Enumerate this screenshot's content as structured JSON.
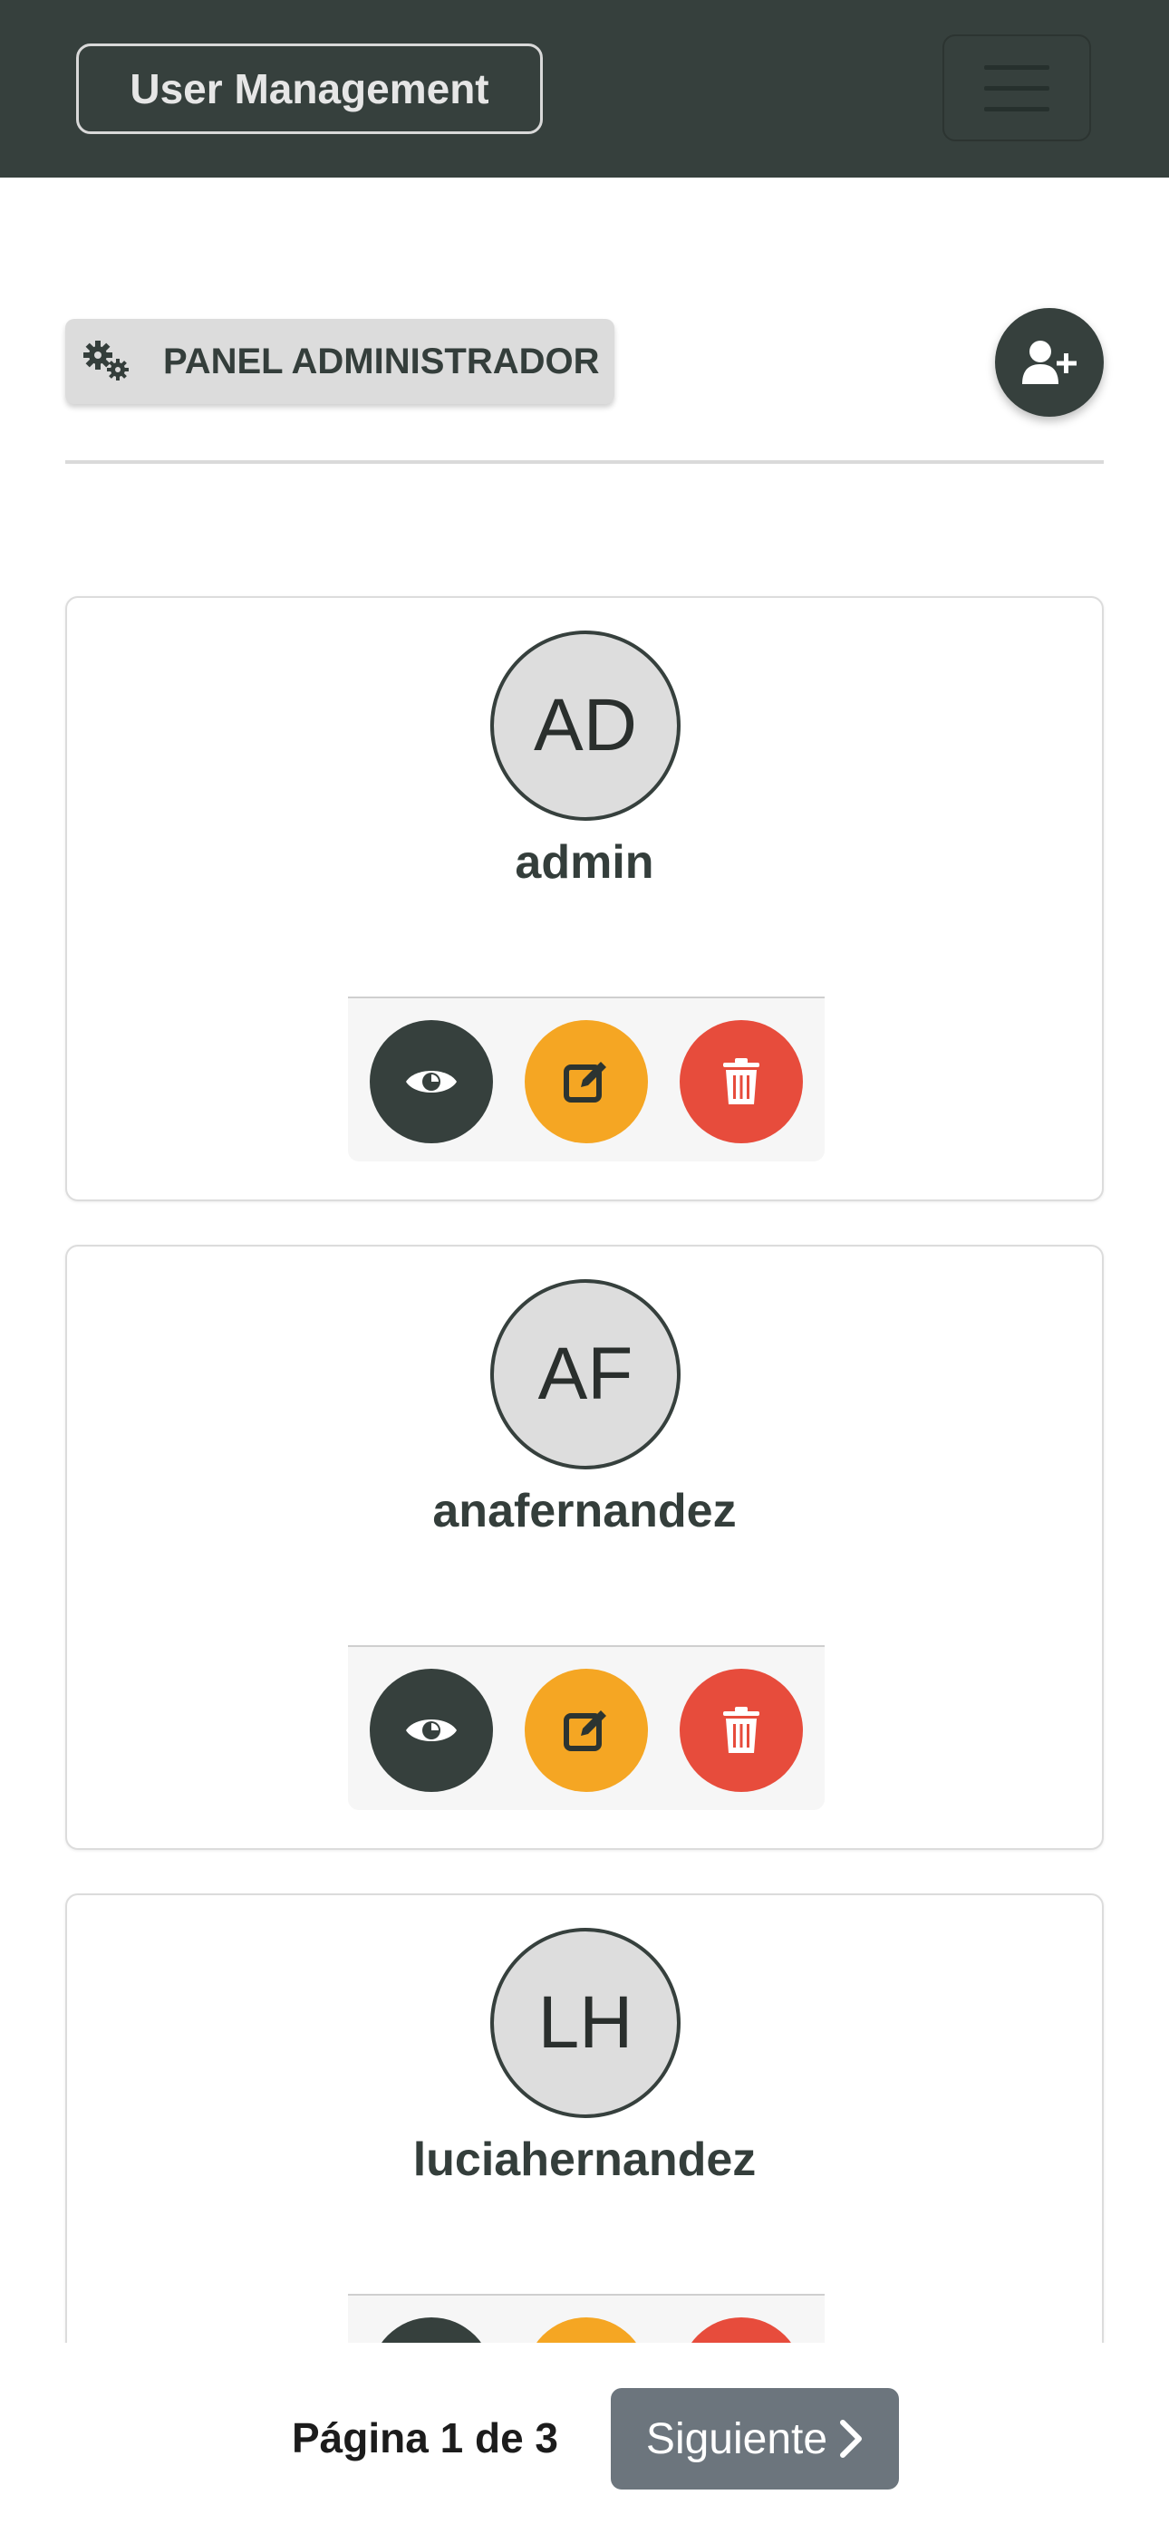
{
  "navbar": {
    "brand": "User Management",
    "menu_icon": "hamburger-icon"
  },
  "admin": {
    "panel_label": "PANEL ADMINISTRADOR",
    "panel_icon": "gears-icon",
    "add_user_icon": "user-plus-icon"
  },
  "users": [
    {
      "initials": "AD",
      "username": "admin"
    },
    {
      "initials": "AF",
      "username": "anafernandez"
    },
    {
      "initials": "LH",
      "username": "luciahernandez"
    }
  ],
  "actions": {
    "view_icon": "eye-icon",
    "edit_icon": "edit-icon",
    "delete_icon": "trash-icon"
  },
  "pagination": {
    "label": "Página 1 de 3",
    "next_label": "Siguiente",
    "next_icon": "chevron-right-icon"
  },
  "colors": {
    "primary": "#36403d",
    "edit": "#f5a623",
    "delete": "#e74c3c",
    "next_button": "#6c757d"
  }
}
